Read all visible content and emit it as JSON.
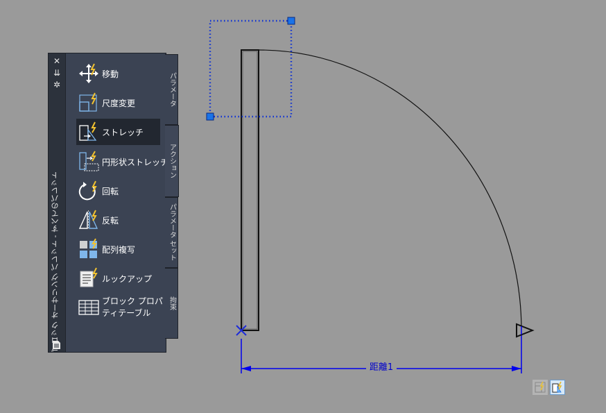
{
  "palette": {
    "title": "ブロック オーサリング パレット - すべてのパレット",
    "controls": {
      "close": "✕",
      "pin": "⇊",
      "settings": "✲"
    },
    "items": [
      {
        "label": "移動",
        "icon": "move-action-icon"
      },
      {
        "label": "尺度変更",
        "icon": "scale-action-icon"
      },
      {
        "label": "ストレッチ",
        "icon": "stretch-action-icon"
      },
      {
        "label": "円形状ストレッチ",
        "icon": "polar-stretch-action-icon"
      },
      {
        "label": "回転",
        "icon": "rotate-action-icon"
      },
      {
        "label": "反転",
        "icon": "flip-action-icon"
      },
      {
        "label": "配列複写",
        "icon": "array-action-icon"
      },
      {
        "label": "ルックアップ",
        "icon": "lookup-action-icon"
      },
      {
        "label_line1": "ブロック プロパ",
        "label_line2": "ティテーブル",
        "icon": "block-properties-table-icon"
      }
    ],
    "active_item": "ストレッチ",
    "tabs": [
      {
        "label": "パラメータ"
      },
      {
        "label": "アクション"
      },
      {
        "label": "パラメータ セット"
      },
      {
        "label": "拘束"
      }
    ],
    "active_tab": "アクション"
  },
  "drawing": {
    "dimension_label": "距離1",
    "colors": {
      "background": "#9a9a9a",
      "dimension": "#0000ee",
      "geometry": "#000000",
      "grip": "#1a73e8"
    }
  }
}
